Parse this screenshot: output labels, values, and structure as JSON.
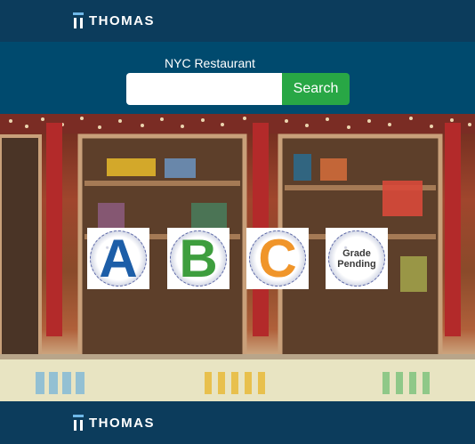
{
  "header": {
    "brand": "THOMAS",
    "brand_icon": "thomas-logo-mark"
  },
  "search": {
    "label": "NYC Restaurant",
    "value": "",
    "placeholder": "",
    "button_label": "Search",
    "button_color": "#28a745"
  },
  "grades": [
    {
      "letter": "A",
      "color": "#1d5ea8"
    },
    {
      "letter": "B",
      "color": "#3e9e3e"
    },
    {
      "letter": "C",
      "color": "#f0952a"
    },
    {
      "line1": "Grade",
      "line2": "Pending",
      "color": "#3a3a3a"
    }
  ],
  "footer": {
    "brand": "THOMAS"
  },
  "colors": {
    "topbar": "#0c3c5c",
    "searchband": "#004a6e",
    "accent": "#6fb8e8"
  }
}
